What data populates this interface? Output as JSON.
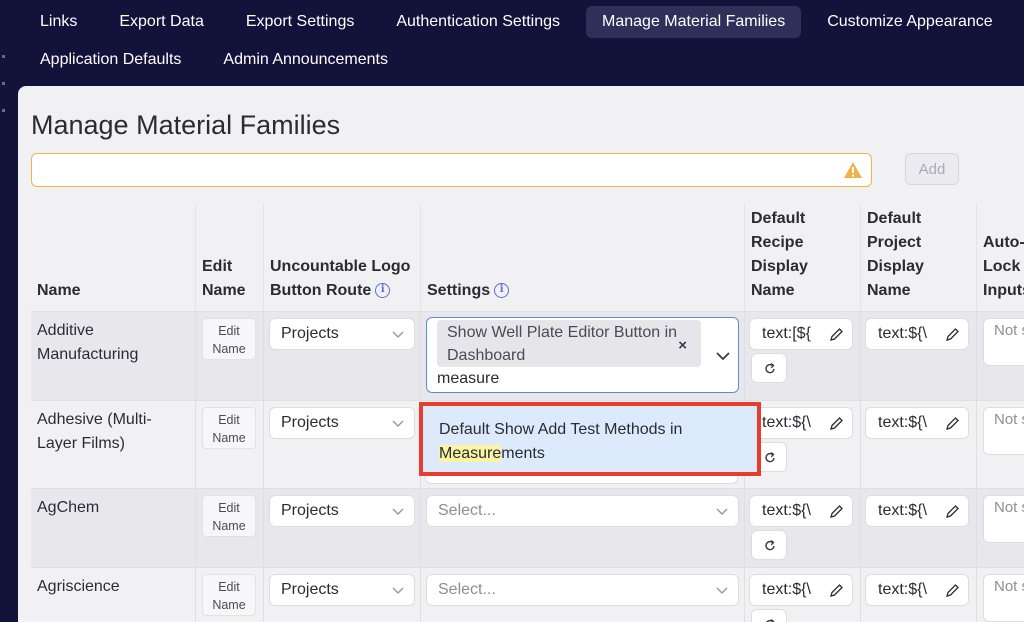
{
  "nav": {
    "row1": [
      "Links",
      "Export Data",
      "Export Settings",
      "Authentication Settings",
      "Manage Material Families",
      "Customize Appearance"
    ],
    "row2": [
      "Application Defaults",
      "Admin Announcements"
    ],
    "active": "Manage Material Families"
  },
  "page": {
    "title": "Manage Material Families",
    "name_input": {
      "value": "",
      "placeholder": ""
    },
    "add_label": "Add"
  },
  "table": {
    "headers": {
      "name": "Name",
      "edit_name": "Edit Name",
      "logo_route": "Uncountable Logo Button Route",
      "settings": "Settings",
      "recipe_display": "Default Recipe Display Name",
      "project_display": "Default Project Display Name",
      "auto_lock": "Auto-Lock Inputs"
    },
    "edit_label": "Edit Name",
    "rows": [
      {
        "name": "Additive Manufacturing",
        "route": "Projects",
        "recipe": "text:[${",
        "project": "text:${\\",
        "auto_lock": "Not set"
      },
      {
        "name": "Adhesive (Multi-Layer Films)",
        "route": "Projects",
        "recipe": "text:${\\",
        "project": "text:${\\",
        "auto_lock": "Not set"
      },
      {
        "name": "AgChem",
        "route": "Projects",
        "settings_placeholder": "Select...",
        "recipe": "text:${\\",
        "project": "text:${\\",
        "auto_lock": "Not set"
      },
      {
        "name": "Agriscience",
        "route": "Projects",
        "settings_placeholder": "Select...",
        "recipe": "text:${\\",
        "project": "text:${\\",
        "auto_lock": "Not set"
      }
    ]
  },
  "settings_editor": {
    "selected_chip": "Show Well Plate Editor Button in Dashboard",
    "chip_remove": "×",
    "search_text": "measure",
    "option_prefix": "Default Show Add Test Methods in ",
    "option_match": "Measure",
    "option_suffix": "ments"
  },
  "colors": {
    "nav_bg": "#12123a",
    "active_tab": "#2f3059",
    "focus_border": "#5a8de2",
    "highlight_box": "#e63d2f",
    "warning": "#f1b24a"
  }
}
